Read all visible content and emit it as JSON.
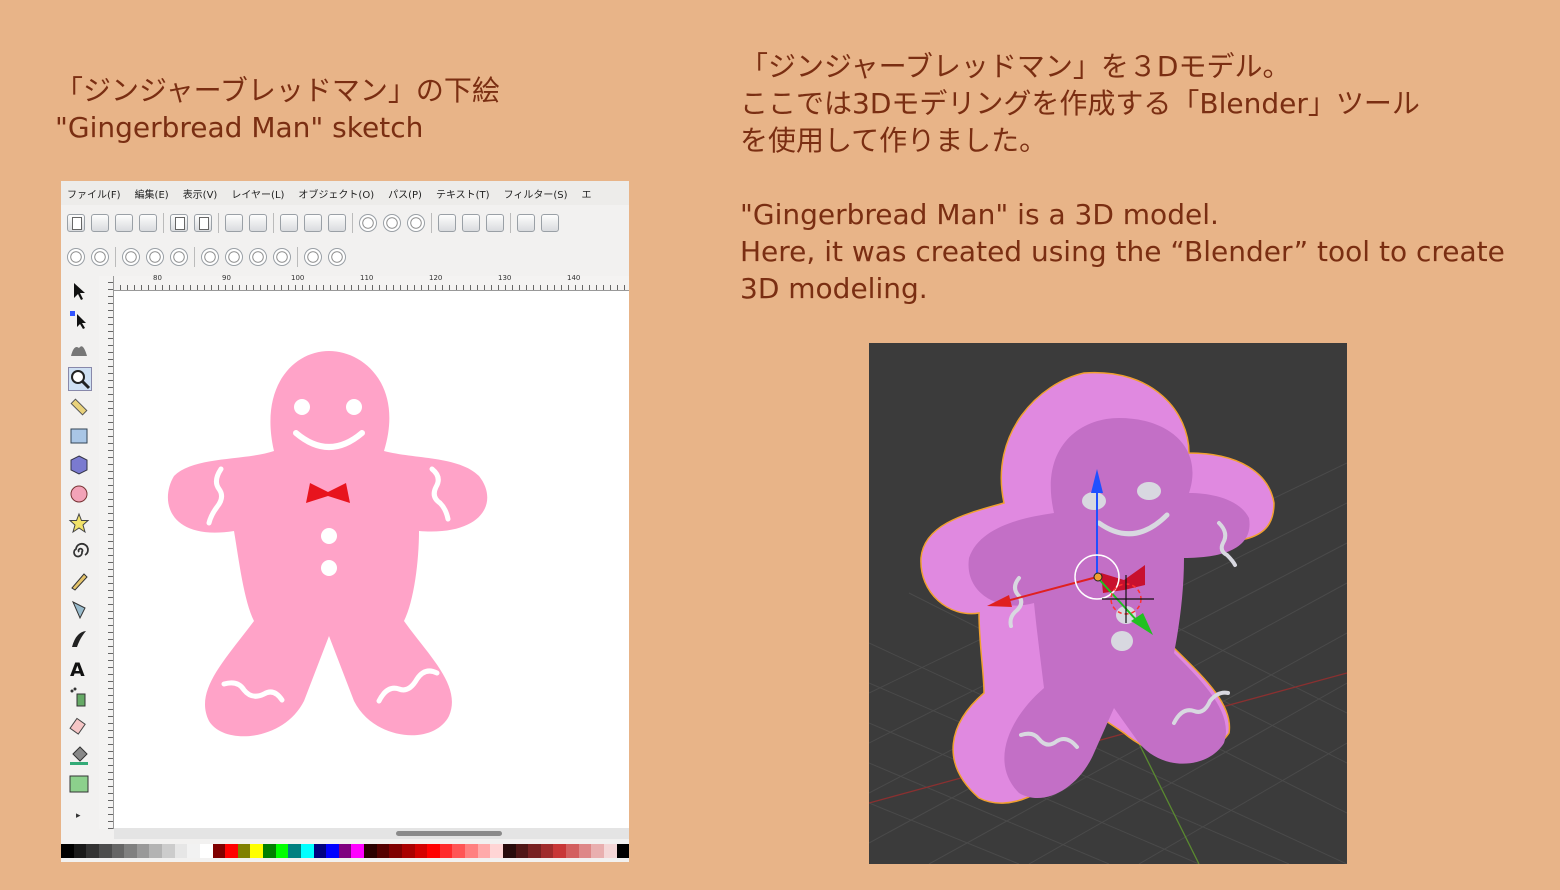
{
  "left_caption": {
    "line1": "「ジンジャーブレッドマン」の下絵",
    "line2": "\"Gingerbread Man\" sketch"
  },
  "right_caption_jp": {
    "line1": "「ジンジャーブレッドマン」を３Dモデル。",
    "line2": "ここでは3Dモデリングを作成する「Blender」ツール",
    "line3": "を使用して作りました。"
  },
  "right_caption_en": {
    "line1": "\"Gingerbread Man\" is a 3D model.",
    "line2": "Here, it was created using the “Blender” tool to create",
    "line3": "3D modeling."
  },
  "inkscape": {
    "menu": [
      "ファイル(F)",
      "編集(E)",
      "表示(V)",
      "レイヤー(L)",
      "オブジェクト(O)",
      "パス(P)",
      "テキスト(T)",
      "フィルター(S)",
      "エ"
    ],
    "ruler_labels": [
      "80",
      "90",
      "100",
      "110",
      "120",
      "130",
      "140"
    ],
    "tools": [
      "select-tool-icon",
      "node-tool-icon",
      "tweak-tool-icon",
      "zoom-tool-icon",
      "measure-tool-icon",
      "rect-tool-icon",
      "box3d-tool-icon",
      "circle-tool-icon",
      "star-tool-icon",
      "spiral-tool-icon",
      "pencil-tool-icon",
      "pen-tool-icon",
      "calligraphy-tool-icon",
      "text-tool-icon",
      "spray-tool-icon",
      "eraser-tool-icon",
      "bucket-tool-icon",
      "gradient-tool-icon"
    ],
    "palette": [
      "#000000",
      "#1a1a1a",
      "#333333",
      "#4d4d4d",
      "#666666",
      "#808080",
      "#999999",
      "#b3b3b3",
      "#cccccc",
      "#e6e6e6",
      "#f2f2f2",
      "#ffffff",
      "#800000",
      "#ff0000",
      "#808000",
      "#ffff00",
      "#008000",
      "#00ff00",
      "#008080",
      "#00ffff",
      "#000080",
      "#0000ff",
      "#800080",
      "#ff00ff",
      "#2b0000",
      "#550000",
      "#800000",
      "#aa0000",
      "#d40000",
      "#ff0000",
      "#ff2a2a",
      "#ff5555",
      "#ff8080",
      "#ffaaaa",
      "#ffd5d5",
      "#280b0b",
      "#501616",
      "#782121",
      "#a02c2c",
      "#c83737",
      "#d35f5f",
      "#de8787",
      "#e9afaf",
      "#f4d7d7",
      "#000000"
    ]
  },
  "colors": {
    "background": "#e8b488",
    "caption_text": "#7a2e12",
    "sketch_pink": "#ffa3c8",
    "bowtie_red": "#e8141e",
    "model_pink": "#e089e0",
    "model_face": "#c36fc6",
    "viewport_bg": "#3b3b3b"
  }
}
